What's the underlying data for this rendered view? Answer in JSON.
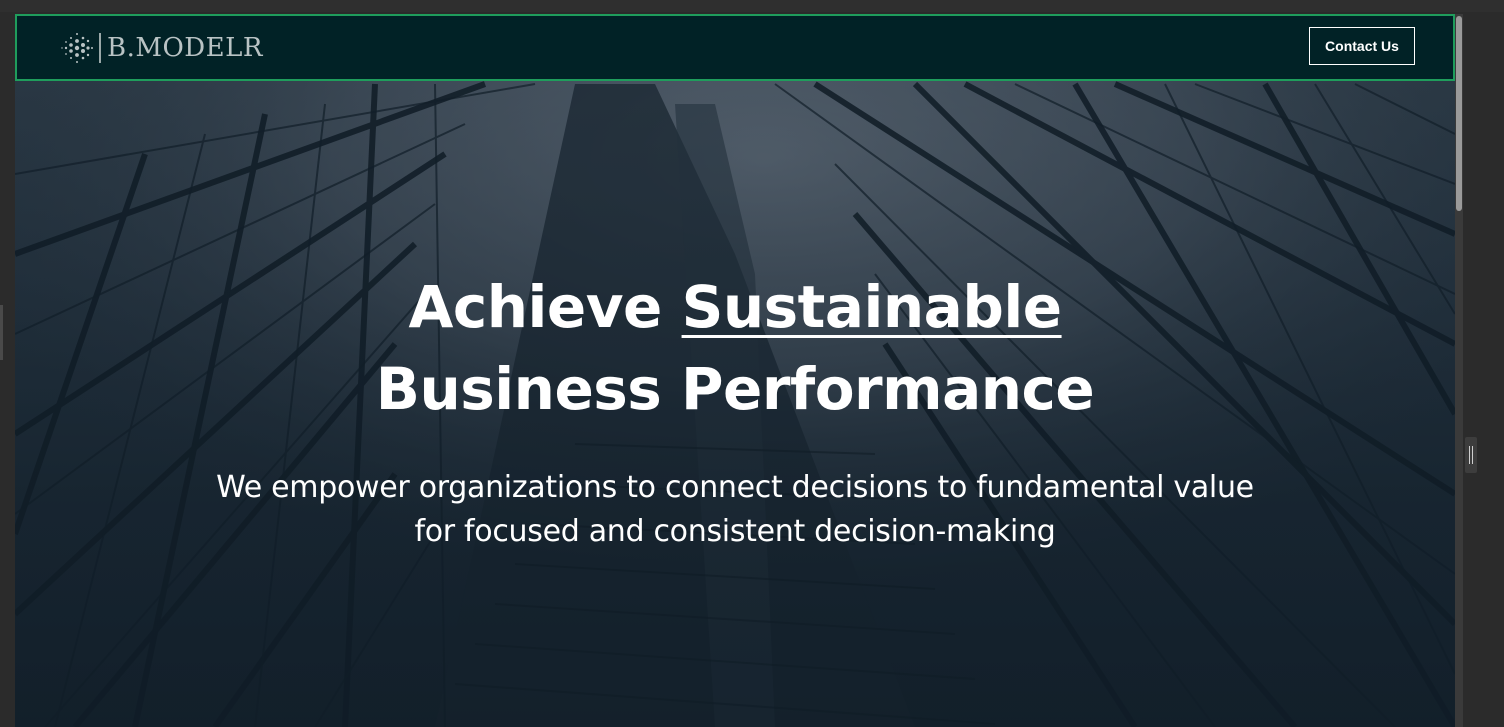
{
  "brand": {
    "logo_text": "B.MODELR",
    "logo_icon": "globe-dots-icon"
  },
  "navbar": {
    "contact_label": "Contact Us"
  },
  "hero": {
    "headline_prefix": "Achieve",
    "headline_underlined": "Sustainable",
    "headline_line2": "Business Performance",
    "subline_line1": "We empower organizations to connect decisions to fundamental value",
    "subline_line2": "for focused and consistent decision-making"
  },
  "colors": {
    "navbar_bg": "#012226",
    "navbar_border": "#1f9d5c",
    "hero_text": "#ffffff"
  }
}
